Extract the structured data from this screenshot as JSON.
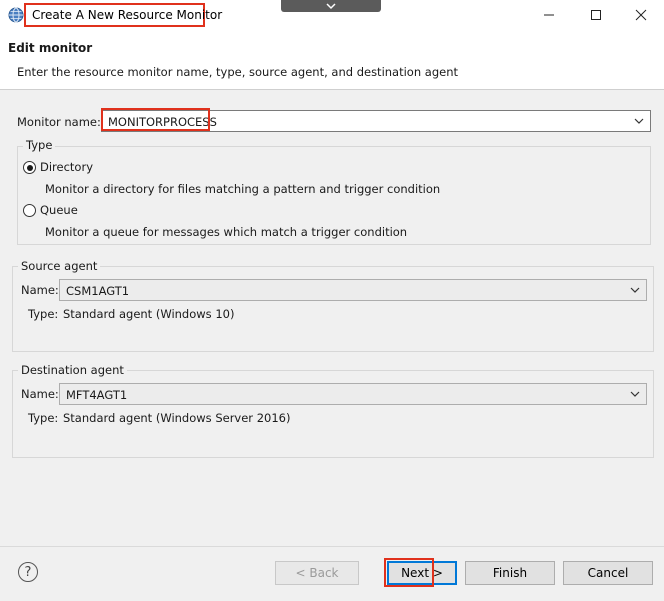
{
  "window": {
    "title": "Create A New Resource Monitor",
    "controls": [
      "minimize",
      "maximize",
      "close"
    ]
  },
  "header": {
    "title": "Edit monitor",
    "description": "Enter the resource monitor name, type, source agent, and destination agent"
  },
  "monitor_name": {
    "label": "Monitor name:",
    "value": "MONITORPROCESS"
  },
  "type_group": {
    "title": "Type",
    "options": [
      {
        "label": "Directory",
        "description": "Monitor a directory for files matching a pattern and trigger condition",
        "selected": true
      },
      {
        "label": "Queue",
        "description": "Monitor a queue for messages which match a trigger condition",
        "selected": false
      }
    ]
  },
  "source_agent": {
    "title": "Source agent",
    "name_label": "Name:",
    "name_value": "CSM1AGT1",
    "type_label": "Type:",
    "type_value": "Standard agent (Windows 10)"
  },
  "destination_agent": {
    "title": "Destination agent",
    "name_label": "Name:",
    "name_value": "MFT4AGT1",
    "type_label": "Type:",
    "type_value": "Standard agent (Windows Server 2016)"
  },
  "buttons": {
    "help": "?",
    "back": "< Back",
    "next": "Next >",
    "finish": "Finish",
    "cancel": "Cancel"
  },
  "colors": {
    "highlight": "#e0311c",
    "default_button_border": "#0078d7"
  }
}
